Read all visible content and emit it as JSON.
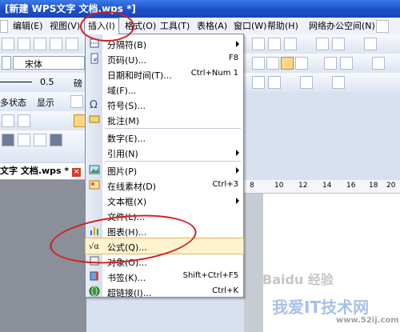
{
  "window": {
    "title": "[新建 WPS文字 文档.wps *]"
  },
  "menubar": {
    "items": [
      {
        "label": "编辑(E)"
      },
      {
        "label": "视图(V)"
      },
      {
        "label": "插入(I)"
      },
      {
        "label": "格式(O)"
      },
      {
        "label": "工具(T)"
      },
      {
        "label": "表格(A)"
      },
      {
        "label": "窗口(W)"
      },
      {
        "label": "帮助(H)"
      },
      {
        "label": "网络办公空间(N)"
      }
    ]
  },
  "left_toolbar": {
    "font_name": "宋体",
    "line_width": "0.5",
    "line_unit": "磅",
    "status_label": "多状态",
    "display_label": "显示"
  },
  "doc_tab": {
    "name": "文字 文档.wps *",
    "close": "×"
  },
  "ruler": {
    "ticks": [
      "8",
      "10",
      "12",
      "14",
      "16",
      "18",
      "20"
    ]
  },
  "insert_menu": {
    "items": [
      {
        "label": "分隔符(B)",
        "shortcut": "",
        "submenu": true
      },
      {
        "label": "页码(U)...",
        "shortcut": "F8",
        "submenu": false
      },
      {
        "label": "日期和时间(T)...",
        "shortcut": "Ctrl+Num 1",
        "submenu": false
      },
      {
        "label": "域(F)...",
        "shortcut": "",
        "submenu": false
      },
      {
        "label": "符号(S)...",
        "shortcut": "",
        "submenu": false
      },
      {
        "label": "批注(M)",
        "shortcut": "",
        "submenu": false
      },
      {
        "label": "数字(E)...",
        "shortcut": "",
        "submenu": false
      },
      {
        "label": "引用(N)",
        "shortcut": "",
        "submenu": true
      },
      {
        "label": "图片(P)",
        "shortcut": "",
        "submenu": true
      },
      {
        "label": "在线素材(D)",
        "shortcut": "Ctrl+3",
        "submenu": false
      },
      {
        "label": "文本框(X)",
        "shortcut": "",
        "submenu": true
      },
      {
        "label": "文件(L)...",
        "shortcut": "",
        "submenu": false
      },
      {
        "label": "图表(H)...",
        "shortcut": "",
        "submenu": false
      },
      {
        "label": "公式(Q)...",
        "shortcut": "",
        "submenu": false
      },
      {
        "label": "对象(O)...",
        "shortcut": "",
        "submenu": false
      },
      {
        "label": "书签(K)...",
        "shortcut": "Shift+Ctrl+F5",
        "submenu": false
      },
      {
        "label": "超链接(I)...",
        "shortcut": "Ctrl+K",
        "submenu": false
      }
    ]
  },
  "watermark": {
    "brand": "Baidu 经验",
    "site_name": "我爱IT技术网",
    "url": "www.52ij.com"
  },
  "colors": {
    "title_bar": "#1b50c9",
    "highlight": "#fff3cf",
    "annotation": "#d51d1d"
  }
}
